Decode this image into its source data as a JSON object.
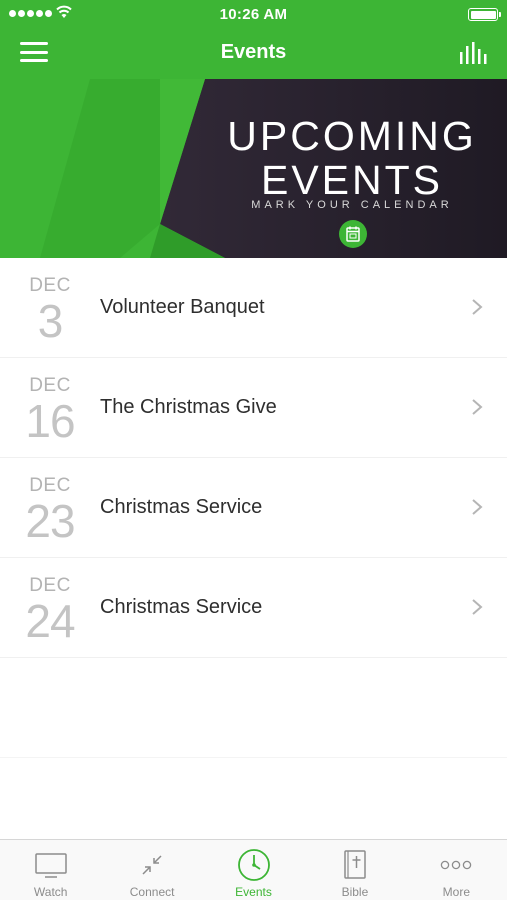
{
  "status_bar": {
    "time": "10:26 AM"
  },
  "nav": {
    "title": "Events"
  },
  "banner": {
    "line1": "UPCOMING",
    "line2": "EVENTS",
    "subtitle": "MARK YOUR CALENDAR"
  },
  "events": [
    {
      "month": "DEC",
      "day": "3",
      "title": "Volunteer Banquet"
    },
    {
      "month": "DEC",
      "day": "16",
      "title": "The Christmas Give"
    },
    {
      "month": "DEC",
      "day": "23",
      "title": "Christmas Service"
    },
    {
      "month": "DEC",
      "day": "24",
      "title": "Christmas Service"
    }
  ],
  "tabs": [
    {
      "label": "Watch",
      "icon": "tv-icon",
      "active": false
    },
    {
      "label": "Connect",
      "icon": "connect-arrows-icon",
      "active": false
    },
    {
      "label": "Events",
      "icon": "clock-icon",
      "active": true
    },
    {
      "label": "Bible",
      "icon": "bible-icon",
      "active": false
    },
    {
      "label": "More",
      "icon": "more-dots-icon",
      "active": false
    }
  ],
  "colors": {
    "brand_green": "#3db535",
    "banner_dark": "#2a2330",
    "inactive_tab": "#8c8c8c"
  }
}
